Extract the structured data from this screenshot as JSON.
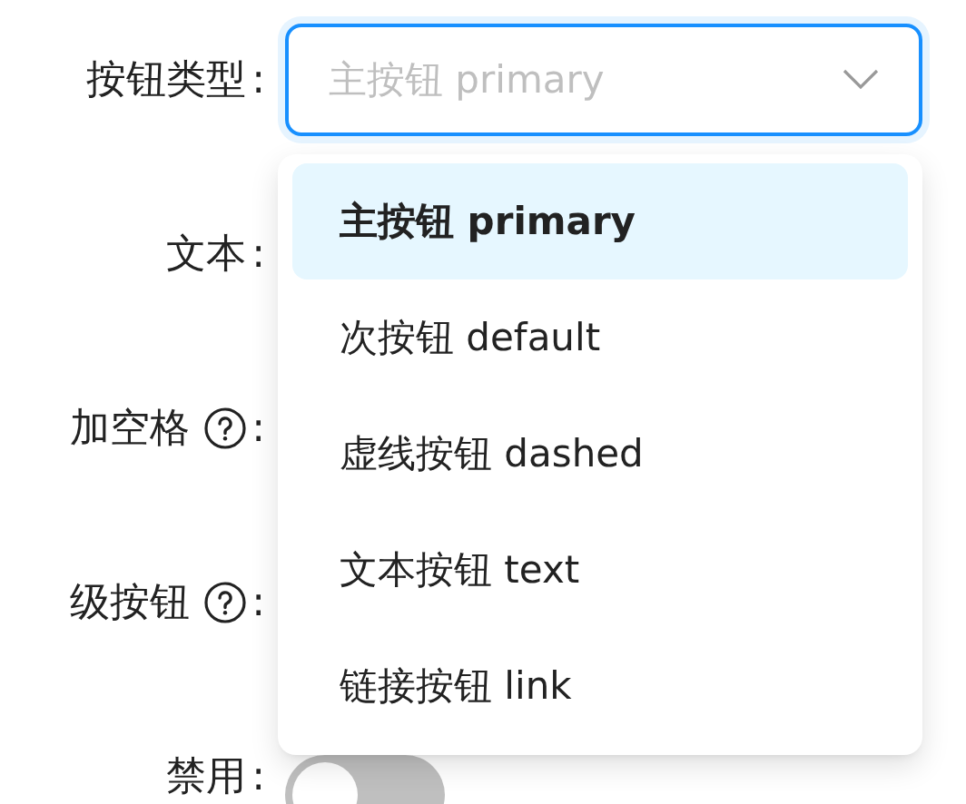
{
  "form": {
    "rows": [
      {
        "label": "按钮类型",
        "help": false,
        "suffix": ":",
        "kind": "select"
      },
      {
        "label": "文本",
        "help": false,
        "suffix": ":",
        "kind": "hidden"
      },
      {
        "label": "加空格",
        "help": true,
        "suffix": ":",
        "kind": "hidden"
      },
      {
        "label": "级按钮",
        "help": true,
        "suffix": ":",
        "kind": "hidden"
      },
      {
        "label": "禁用",
        "help": false,
        "suffix": ":",
        "kind": "switch",
        "on": false
      }
    ]
  },
  "select": {
    "placeholder": "主按钮 primary",
    "expanded": true
  },
  "dropdown": {
    "options": [
      {
        "label": "主按钮 primary",
        "selected": true
      },
      {
        "label": "次按钮 default",
        "selected": false
      },
      {
        "label": "虚线按钮 dashed",
        "selected": false
      },
      {
        "label": "文本按钮 text",
        "selected": false
      },
      {
        "label": "链接按钮 link",
        "selected": false
      }
    ]
  }
}
